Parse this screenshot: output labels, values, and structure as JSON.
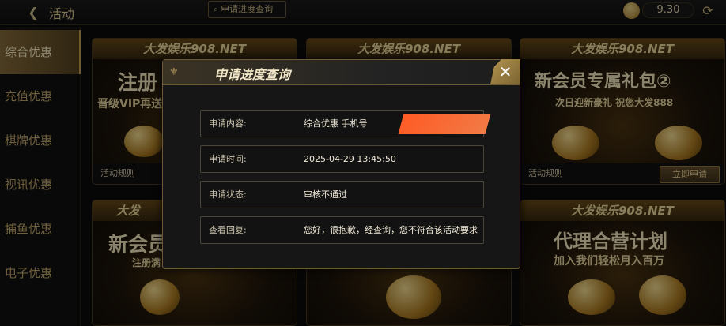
{
  "topbar": {
    "back_glyph": "❮",
    "title": "活动",
    "query_button_label": "申请进度查询",
    "balance": "9.30"
  },
  "sidebar": {
    "items": [
      {
        "label": "综合优惠",
        "active": true
      },
      {
        "label": "充值优惠"
      },
      {
        "label": "棋牌优惠"
      },
      {
        "label": "视讯优惠"
      },
      {
        "label": "捕鱼优惠"
      },
      {
        "label": "电子优惠"
      }
    ]
  },
  "cards": [
    {
      "banner": "大发娱乐908.NET",
      "headline": "注册",
      "sub": "晋级VIP再送",
      "foot": "活动规则"
    },
    {
      "banner": "大发娱乐908.NET",
      "headline": "",
      "sub": ""
    },
    {
      "banner": "大发娱乐908.NET",
      "headline": "新会员专属礼包②",
      "sub": "次日迎新豪礼 祝您大发888",
      "foot": "活动规则",
      "apply": "立即申请"
    },
    {
      "banner": "大发",
      "headline": "新会员",
      "sub": "注册满"
    },
    {
      "banner": "",
      "headline": "",
      "sub": ""
    },
    {
      "banner": "大发娱乐908.NET",
      "headline": "代理合营计划",
      "sub": "加入我们轻松月入百万"
    }
  ],
  "modal": {
    "title": "申请进度查询",
    "close_glyph": "✕",
    "rows": [
      {
        "label": "申请内容:",
        "value": "综合优惠 手机号"
      },
      {
        "label": "申请时间:",
        "value": "2025-04-29 13:45:50"
      },
      {
        "label": "申请状态:",
        "value": "审核不通过"
      },
      {
        "label": "查看回复:",
        "value": "您好，很抱歉，经查询，您不符合该活动要求"
      }
    ]
  },
  "colors": {
    "accent_gold": "#caa55a",
    "redaction": "#ff6a32"
  }
}
